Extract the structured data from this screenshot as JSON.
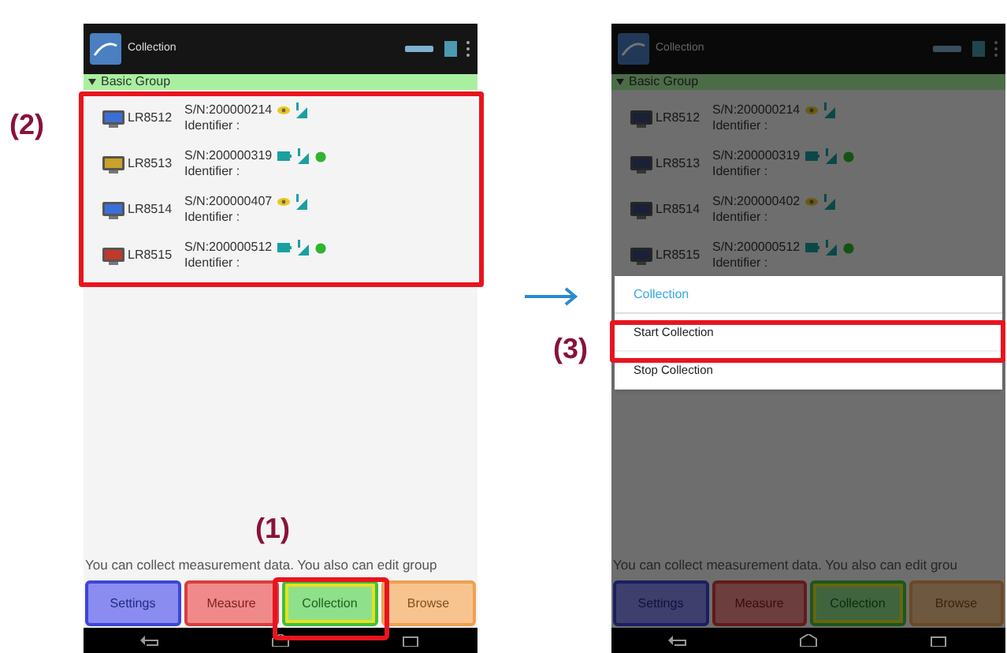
{
  "screens": [
    {
      "title": "Collection",
      "group": "Basic Group",
      "devices": [
        {
          "model": "LR8512",
          "serial": "S/N:200000214",
          "identifier": "Identifier :",
          "kind": "eye",
          "color": "#3b6fd8",
          "link": false
        },
        {
          "model": "LR8513",
          "serial": "S/N:200000319",
          "identifier": "Identifier :",
          "kind": "battery",
          "color": "#c9a227",
          "link": true
        },
        {
          "model": "LR8514",
          "serial": "S/N:200000407",
          "identifier": "Identifier :",
          "kind": "eye",
          "color": "#3b6fd8",
          "link": false
        },
        {
          "model": "LR8515",
          "serial": "S/N:200000512",
          "identifier": "Identifier :",
          "kind": "battery",
          "color": "#c0392b",
          "link": true
        }
      ],
      "hint": "You can collect measurement data. You also can edit group",
      "buttons": [
        {
          "label": "Settings",
          "kind": "settings",
          "selected": false
        },
        {
          "label": "Measure",
          "kind": "measure",
          "selected": false
        },
        {
          "label": "Collection",
          "kind": "collection",
          "selected": true
        },
        {
          "label": "Browse",
          "kind": "browse",
          "selected": false
        }
      ]
    },
    {
      "title": "Collection",
      "group": "Basic Group",
      "devices": [
        {
          "model": "LR8512",
          "serial": "S/N:200000214",
          "identifier": "Identifier :",
          "kind": "eye",
          "link": false
        },
        {
          "model": "LR8513",
          "serial": "S/N:200000319",
          "identifier": "Identifier :",
          "kind": "battery",
          "link": true
        },
        {
          "model": "LR8514",
          "serial": "S/N:200000402",
          "identifier": "Identifier :",
          "kind": "eye",
          "link": false
        },
        {
          "model": "LR8515",
          "serial": "S/N:200000512",
          "identifier": "Identifier :",
          "kind": "battery",
          "link": true
        }
      ],
      "hint": "You can collect measurement data. You also can edit grou",
      "dimmed": true,
      "buttons": [
        {
          "label": "Settings",
          "kind": "settings",
          "selected": false
        },
        {
          "label": "Measure",
          "kind": "measure",
          "selected": false
        },
        {
          "label": "Collection",
          "kind": "collection",
          "selected": true
        },
        {
          "label": "Browse",
          "kind": "browse",
          "selected": false
        }
      ],
      "dialog": {
        "title": "Collection",
        "items": [
          "Start Collection",
          "Stop Collection"
        ]
      }
    }
  ],
  "callouts": [
    {
      "label": "(2)"
    },
    {
      "label": "(1)"
    },
    {
      "label": "(3)"
    }
  ]
}
